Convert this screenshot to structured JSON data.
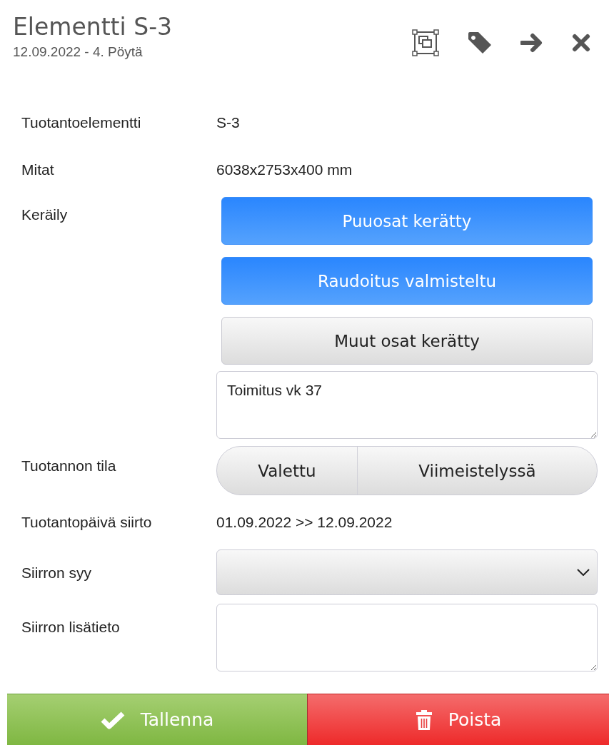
{
  "header": {
    "title": "Elementti S-3",
    "subtitle": "12.09.2022 - 4. Pöytä"
  },
  "fields": [
    {
      "kind": "text",
      "label": "Tuotantoelementti",
      "value": "S-3"
    },
    {
      "kind": "text",
      "label": "Mitat",
      "value": "6038x2753x400 mm"
    },
    {
      "kind": "toggles",
      "label": "Keräily",
      "toggles": [
        {
          "label": "Puuosat kerätty",
          "selected": true
        },
        {
          "label": "Raudoitus valmisteltu",
          "selected": true
        },
        {
          "label": "Muut osat kerätty",
          "selected": false
        }
      ],
      "note": "Toimitus vk 37"
    },
    {
      "kind": "segments",
      "label": "Tuotannon tila",
      "segments": [
        "Valettu",
        "Viimeistelyssä"
      ]
    },
    {
      "kind": "text",
      "label": "Tuotantopäivä siirto",
      "value": "01.09.2022 >> 12.09.2022"
    },
    {
      "kind": "select",
      "label": "Siirron syy"
    },
    {
      "kind": "textarea",
      "label": "Siirron lisätieto"
    }
  ],
  "actions": [
    {
      "kind": "save",
      "label": "Tallenna"
    },
    {
      "kind": "delete",
      "label": "Poista"
    }
  ]
}
